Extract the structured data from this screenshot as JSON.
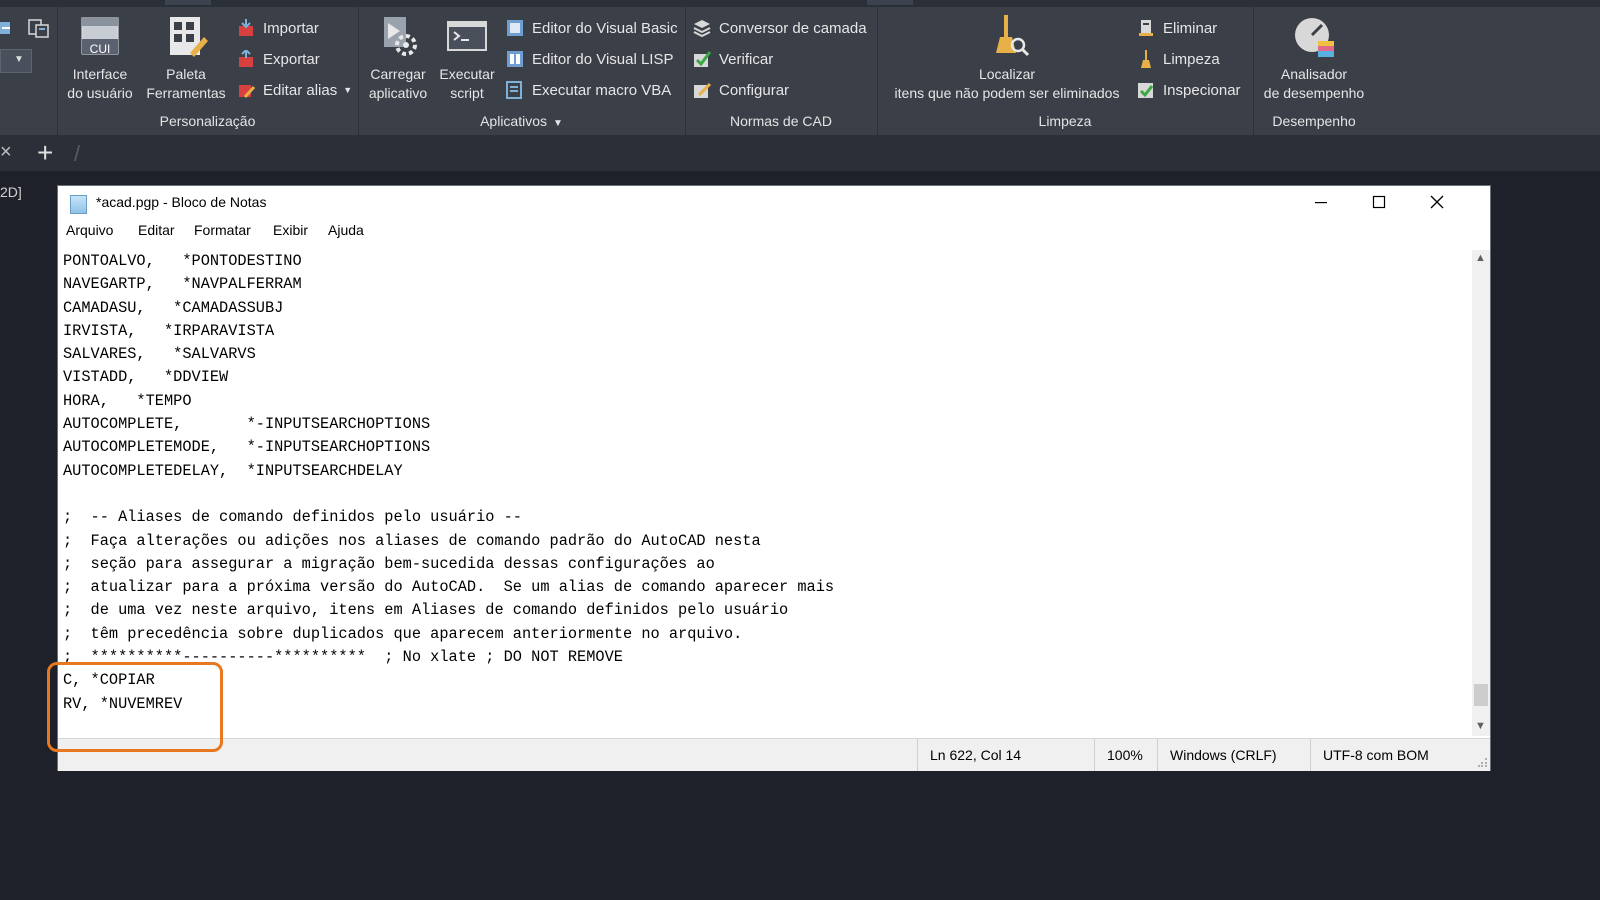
{
  "ribbon": {
    "panels": {
      "personalizacao": {
        "title": "Personalização"
      },
      "aplicativos": {
        "title": "Aplicativos"
      },
      "normas": {
        "title": "Normas de CAD"
      },
      "limpeza": {
        "title": "Limpeza"
      },
      "desempenho": {
        "title": "Desempenho"
      }
    },
    "big_buttons": {
      "interface": {
        "icon_text": "CUI",
        "line1": "Interface",
        "line2": "do usuário"
      },
      "paleta": {
        "line1": "Paleta",
        "line2": "Ferramentas"
      },
      "carregar": {
        "line1": "Carregar",
        "line2": "aplicativo"
      },
      "executar": {
        "line1": "Executar",
        "line2": "script"
      },
      "localizar": {
        "line1": "Localizar",
        "line2": "itens que não podem ser eliminados"
      },
      "analisador": {
        "line1": "Analisador",
        "line2": "de desempenho"
      }
    },
    "small_buttons": {
      "importar": "Importar",
      "exportar": "Exportar",
      "editar_alias": "Editar alias",
      "editor_vb": "Editor do Visual Basic",
      "editor_lisp": "Editor do Visual LISP",
      "executar_vba": "Executar macro VBA",
      "conversor": "Conversor de camada",
      "verificar": "Verificar",
      "configurar": "Configurar",
      "eliminar": "Eliminar",
      "limpeza": "Limpeza",
      "inspecionar": "Inspecionar"
    }
  },
  "tabbar": {
    "close_glyph": "×",
    "plus_glyph": "+"
  },
  "viewport_label": "2D]",
  "notepad": {
    "title": "*acad.pgp - Bloco de Notas",
    "menu": [
      "Arquivo",
      "Editar",
      "Formatar",
      "Exibir",
      "Ajuda"
    ],
    "content": "PONTOALVO,   *PONTODESTINO\nNAVEGARTP,   *NAVPALFERRAM\nCAMADASU,   *CAMADASSUBJ\nIRVISTA,   *IRPARAVISTA\nSALVARES,   *SALVARVS\nVISTADD,   *DDVIEW\nHORA,   *TEMPO\nAUTOCOMPLETE,       *-INPUTSEARCHOPTIONS\nAUTOCOMPLETEMODE,   *-INPUTSEARCHOPTIONS\nAUTOCOMPLETEDELAY,  *INPUTSEARCHDELAY\n\n;  -- Aliases de comando definidos pelo usuário --\n;  Faça alterações ou adições nos aliases de comando padrão do AutoCAD nesta\n;  seção para assegurar a migração bem-sucedida dessas configurações ao\n;  atualizar para a próxima versão do AutoCAD.  Se um alias de comando aparecer mais\n;  de uma vez neste arquivo, itens em Aliases de comando definidos pelo usuário\n;  têm precedência sobre duplicados que aparecem anteriormente no arquivo.\n;  **********----------**********  ; No xlate ; DO NOT REMOVE\nC, *COPIAR\nRV, *NUVEMREV",
    "status": {
      "position": "Ln 622, Col 14",
      "zoom": "100%",
      "line_ending": "Windows (CRLF)",
      "encoding": "UTF-8 com BOM"
    }
  },
  "colors": {
    "highlight": "#e87722",
    "ribbon_bg": "#3a3f48",
    "desktop_bg": "#1e2129"
  }
}
